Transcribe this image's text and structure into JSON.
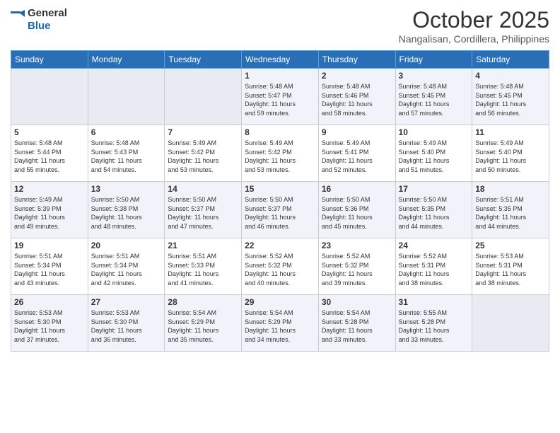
{
  "logo": {
    "line1": "General",
    "line2": "Blue"
  },
  "header": {
    "month": "October 2025",
    "location": "Nangalisan, Cordillera, Philippines"
  },
  "weekdays": [
    "Sunday",
    "Monday",
    "Tuesday",
    "Wednesday",
    "Thursday",
    "Friday",
    "Saturday"
  ],
  "weeks": [
    [
      {
        "day": "",
        "info": ""
      },
      {
        "day": "",
        "info": ""
      },
      {
        "day": "",
        "info": ""
      },
      {
        "day": "1",
        "info": "Sunrise: 5:48 AM\nSunset: 5:47 PM\nDaylight: 11 hours\nand 59 minutes."
      },
      {
        "day": "2",
        "info": "Sunrise: 5:48 AM\nSunset: 5:46 PM\nDaylight: 11 hours\nand 58 minutes."
      },
      {
        "day": "3",
        "info": "Sunrise: 5:48 AM\nSunset: 5:45 PM\nDaylight: 11 hours\nand 57 minutes."
      },
      {
        "day": "4",
        "info": "Sunrise: 5:48 AM\nSunset: 5:45 PM\nDaylight: 11 hours\nand 56 minutes."
      }
    ],
    [
      {
        "day": "5",
        "info": "Sunrise: 5:48 AM\nSunset: 5:44 PM\nDaylight: 11 hours\nand 55 minutes."
      },
      {
        "day": "6",
        "info": "Sunrise: 5:48 AM\nSunset: 5:43 PM\nDaylight: 11 hours\nand 54 minutes."
      },
      {
        "day": "7",
        "info": "Sunrise: 5:49 AM\nSunset: 5:42 PM\nDaylight: 11 hours\nand 53 minutes."
      },
      {
        "day": "8",
        "info": "Sunrise: 5:49 AM\nSunset: 5:42 PM\nDaylight: 11 hours\nand 53 minutes."
      },
      {
        "day": "9",
        "info": "Sunrise: 5:49 AM\nSunset: 5:41 PM\nDaylight: 11 hours\nand 52 minutes."
      },
      {
        "day": "10",
        "info": "Sunrise: 5:49 AM\nSunset: 5:40 PM\nDaylight: 11 hours\nand 51 minutes."
      },
      {
        "day": "11",
        "info": "Sunrise: 5:49 AM\nSunset: 5:40 PM\nDaylight: 11 hours\nand 50 minutes."
      }
    ],
    [
      {
        "day": "12",
        "info": "Sunrise: 5:49 AM\nSunset: 5:39 PM\nDaylight: 11 hours\nand 49 minutes."
      },
      {
        "day": "13",
        "info": "Sunrise: 5:50 AM\nSunset: 5:38 PM\nDaylight: 11 hours\nand 48 minutes."
      },
      {
        "day": "14",
        "info": "Sunrise: 5:50 AM\nSunset: 5:37 PM\nDaylight: 11 hours\nand 47 minutes."
      },
      {
        "day": "15",
        "info": "Sunrise: 5:50 AM\nSunset: 5:37 PM\nDaylight: 11 hours\nand 46 minutes."
      },
      {
        "day": "16",
        "info": "Sunrise: 5:50 AM\nSunset: 5:36 PM\nDaylight: 11 hours\nand 45 minutes."
      },
      {
        "day": "17",
        "info": "Sunrise: 5:50 AM\nSunset: 5:35 PM\nDaylight: 11 hours\nand 44 minutes."
      },
      {
        "day": "18",
        "info": "Sunrise: 5:51 AM\nSunset: 5:35 PM\nDaylight: 11 hours\nand 44 minutes."
      }
    ],
    [
      {
        "day": "19",
        "info": "Sunrise: 5:51 AM\nSunset: 5:34 PM\nDaylight: 11 hours\nand 43 minutes."
      },
      {
        "day": "20",
        "info": "Sunrise: 5:51 AM\nSunset: 5:34 PM\nDaylight: 11 hours\nand 42 minutes."
      },
      {
        "day": "21",
        "info": "Sunrise: 5:51 AM\nSunset: 5:33 PM\nDaylight: 11 hours\nand 41 minutes."
      },
      {
        "day": "22",
        "info": "Sunrise: 5:52 AM\nSunset: 5:32 PM\nDaylight: 11 hours\nand 40 minutes."
      },
      {
        "day": "23",
        "info": "Sunrise: 5:52 AM\nSunset: 5:32 PM\nDaylight: 11 hours\nand 39 minutes."
      },
      {
        "day": "24",
        "info": "Sunrise: 5:52 AM\nSunset: 5:31 PM\nDaylight: 11 hours\nand 38 minutes."
      },
      {
        "day": "25",
        "info": "Sunrise: 5:53 AM\nSunset: 5:31 PM\nDaylight: 11 hours\nand 38 minutes."
      }
    ],
    [
      {
        "day": "26",
        "info": "Sunrise: 5:53 AM\nSunset: 5:30 PM\nDaylight: 11 hours\nand 37 minutes."
      },
      {
        "day": "27",
        "info": "Sunrise: 5:53 AM\nSunset: 5:30 PM\nDaylight: 11 hours\nand 36 minutes."
      },
      {
        "day": "28",
        "info": "Sunrise: 5:54 AM\nSunset: 5:29 PM\nDaylight: 11 hours\nand 35 minutes."
      },
      {
        "day": "29",
        "info": "Sunrise: 5:54 AM\nSunset: 5:29 PM\nDaylight: 11 hours\nand 34 minutes."
      },
      {
        "day": "30",
        "info": "Sunrise: 5:54 AM\nSunset: 5:28 PM\nDaylight: 11 hours\nand 33 minutes."
      },
      {
        "day": "31",
        "info": "Sunrise: 5:55 AM\nSunset: 5:28 PM\nDaylight: 11 hours\nand 33 minutes."
      },
      {
        "day": "",
        "info": ""
      }
    ]
  ]
}
